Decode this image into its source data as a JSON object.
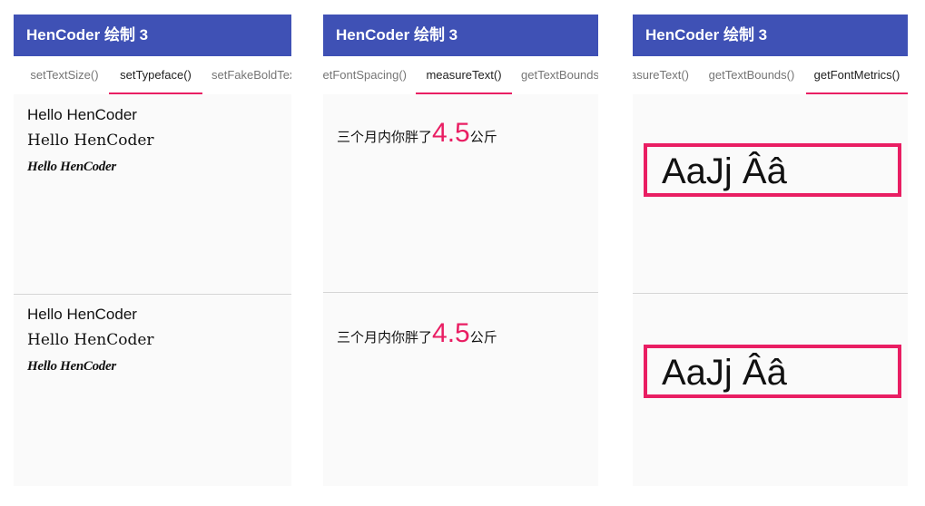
{
  "app_title": "HenCoder 绘制 3",
  "panels": [
    {
      "tabs": [
        "setTextSize()",
        "setTypeface()",
        "setFakeBoldText()"
      ],
      "active_tab": "setTypeface()",
      "sections": [
        {
          "lines": [
            "Hello HenCoder",
            "Hello HenCoder",
            "Hello HenCoder"
          ]
        },
        {
          "lines": [
            "Hello HenCoder",
            "Hello HenCoder",
            "Hello HenCoder"
          ]
        }
      ]
    },
    {
      "tabs": [
        "setFontSpacing()",
        "measureText()",
        "getTextBounds()"
      ],
      "active_tab": "measureText()",
      "sections": [
        {
          "prefix": "三个月内你胖了",
          "number": "4.5",
          "suffix": "公斤"
        },
        {
          "prefix": "三个月内你胖了",
          "number": "4.5",
          "suffix": "公斤"
        }
      ]
    },
    {
      "tabs": [
        "measureText()",
        "getTextBounds()",
        "getFontMetrics()"
      ],
      "active_tab": "getFontMetrics()",
      "sections": [
        {
          "text": "AaJj Ââ"
        },
        {
          "text": "AaJj Ââ"
        }
      ]
    }
  ],
  "colors": {
    "appbar": "#3f51b5",
    "accent": "#e91e63",
    "content_bg": "#fafafa"
  }
}
